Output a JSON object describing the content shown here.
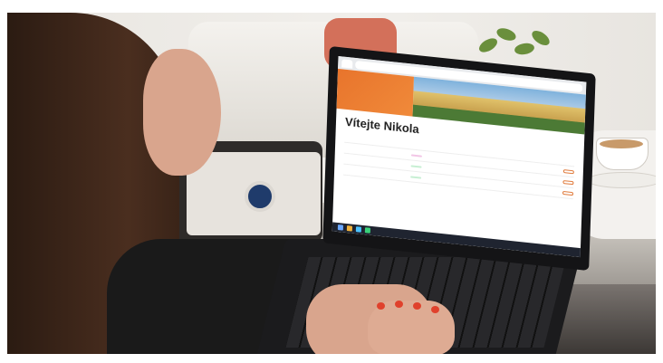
{
  "scene": {
    "colors": {
      "wall": "#e9e6e1",
      "cushion": "#d3705a",
      "banner_orange": "#e8742c",
      "nail_polish": "#e0412c",
      "laptop_body": "#1b1b1d"
    }
  },
  "browser": {
    "tab_label": "",
    "url": ""
  },
  "page": {
    "welcome_heading": "Vítejte Nikola",
    "rows": [
      {
        "label": "",
        "value": ""
      },
      {
        "label": "",
        "value": ""
      },
      {
        "label": "",
        "value": ""
      },
      {
        "label": "",
        "value": ""
      }
    ]
  },
  "taskbar": {
    "clock": ""
  }
}
